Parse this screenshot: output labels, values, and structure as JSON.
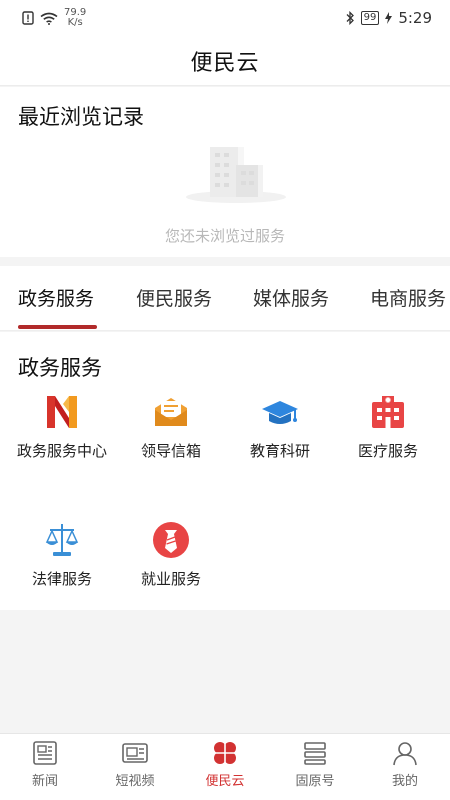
{
  "status_bar": {
    "speed_value": "79.9",
    "speed_unit": "K/s",
    "battery": "99",
    "time": "5:29"
  },
  "header": {
    "title": "便民云"
  },
  "recent": {
    "title": "最近浏览记录",
    "empty_text": "您还未浏览过服务"
  },
  "category_tabs": [
    {
      "label": "政务服务",
      "active": true
    },
    {
      "label": "便民服务",
      "active": false
    },
    {
      "label": "媒体服务",
      "active": false
    },
    {
      "label": "电商服务",
      "active": false
    }
  ],
  "services": {
    "title": "政务服务",
    "items": [
      {
        "label": "政务服务中心",
        "icon": "gov-center-icon"
      },
      {
        "label": "领导信箱",
        "icon": "mailbox-icon"
      },
      {
        "label": "教育科研",
        "icon": "graduation-cap-icon"
      },
      {
        "label": "医疗服务",
        "icon": "hospital-icon"
      },
      {
        "label": "法律服务",
        "icon": "scales-icon"
      },
      {
        "label": "就业服务",
        "icon": "tie-icon"
      }
    ]
  },
  "bottom_tabs": [
    {
      "label": "新闻",
      "icon": "newspaper-icon",
      "active": false
    },
    {
      "label": "短视频",
      "icon": "video-icon",
      "active": false
    },
    {
      "label": "便民云",
      "icon": "clover-icon",
      "active": true
    },
    {
      "label": "固原号",
      "icon": "stack-icon",
      "active": false
    },
    {
      "label": "我的",
      "icon": "person-icon",
      "active": false
    }
  ],
  "colors": {
    "accent": "#b12a2a",
    "active_tab_text": "#d23232",
    "mail_orange": "#f0a033",
    "edu_blue": "#2e86de",
    "hospital_red": "#e84545",
    "legal_blue": "#3a8fd6",
    "job_red": "#e84545"
  }
}
